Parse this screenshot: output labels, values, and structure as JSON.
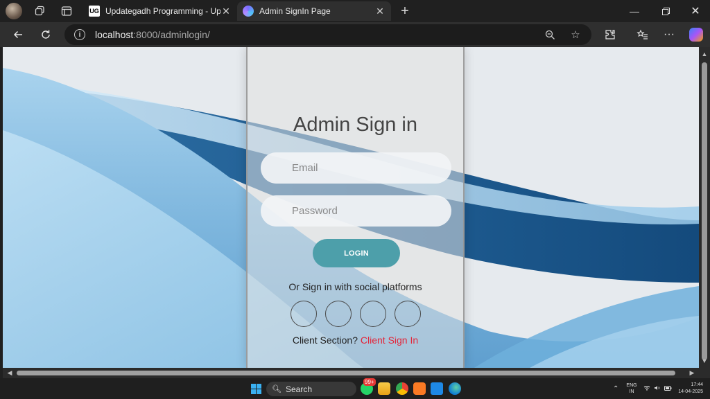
{
  "browser": {
    "tabs": [
      {
        "title": "Updategadh Programming - Upd",
        "favicon_text": "UG",
        "active": false
      },
      {
        "title": "Admin SignIn Page",
        "active": true
      }
    ],
    "url_host": "localhost",
    "url_rest": ":8000/adminlogin/"
  },
  "page": {
    "title": "Admin Sign in",
    "email_placeholder": "Email",
    "password_placeholder": "Password",
    "login_label": "LOGIN",
    "social_text": "Or Sign in with social platforms",
    "client_prefix": "Client Section?",
    "client_link": "Client Sign In"
  },
  "taskbar": {
    "search_label": "Search",
    "badge": "99+",
    "lang_line1": "ENG",
    "lang_line2": "IN",
    "time": "17:44",
    "date": "14-04-2025"
  },
  "colors": {
    "login_button": "#4d9faa",
    "client_link": "#e3263a",
    "windows_blue": "#3ab1f2"
  },
  "icons": [
    "profile-avatar",
    "workspaces-icon",
    "tab-actions-icon",
    "close-icon",
    "new-tab-icon",
    "minimize-icon",
    "restore-icon",
    "back-icon",
    "refresh-icon",
    "site-info-icon",
    "zoom-icon",
    "favorite-star-icon",
    "extensions-icon",
    "favorites-icon",
    "more-icon",
    "copilot-icon"
  ]
}
